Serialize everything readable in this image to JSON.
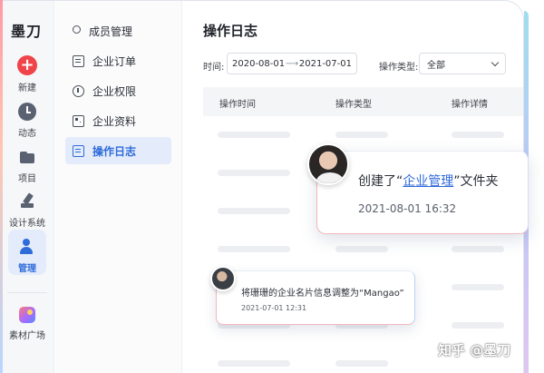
{
  "app": {
    "brand": "墨刀"
  },
  "rail": {
    "items": [
      {
        "label": "新建",
        "icon": "plus-icon"
      },
      {
        "label": "动态",
        "icon": "clock-icon"
      },
      {
        "label": "项目",
        "icon": "folder-icon"
      },
      {
        "label": "设计系统",
        "icon": "pen-icon"
      },
      {
        "label": "管理",
        "icon": "user-icon",
        "active": true
      },
      {
        "label": "素材广场",
        "icon": "material-icon"
      }
    ],
    "new_symbol": "+"
  },
  "submenu": {
    "items": [
      {
        "label": "成员管理",
        "icon": "member-icon"
      },
      {
        "label": "企业订单",
        "icon": "order-icon"
      },
      {
        "label": "企业权限",
        "icon": "permission-icon"
      },
      {
        "label": "企业资料",
        "icon": "info-icon"
      },
      {
        "label": "操作日志",
        "icon": "log-icon",
        "active": true
      }
    ]
  },
  "main": {
    "title": "操作日志",
    "filters": {
      "time_label": "时间:",
      "date_start": "2020-08-01",
      "date_arrow": "⟶",
      "date_end": "2021-07-01",
      "type_label": "操作类型:",
      "type_value": "全部"
    },
    "table": {
      "columns": [
        "操作时间",
        "操作类型",
        "操作详情"
      ]
    }
  },
  "notifications": {
    "big": {
      "prefix": "创建了“",
      "link": "企业管理",
      "suffix": "”文件夹",
      "time": "2021-08-01 16:32"
    },
    "small": {
      "text": "将珊珊的企业名片信息调整为“Mangao”",
      "time": "2021-07-01 12:31"
    }
  },
  "watermark": "知乎 @墨刀",
  "colors": {
    "accent": "#2f6bd9",
    "new_button": "#f0434a",
    "active_bg": "#e4ecfb"
  }
}
